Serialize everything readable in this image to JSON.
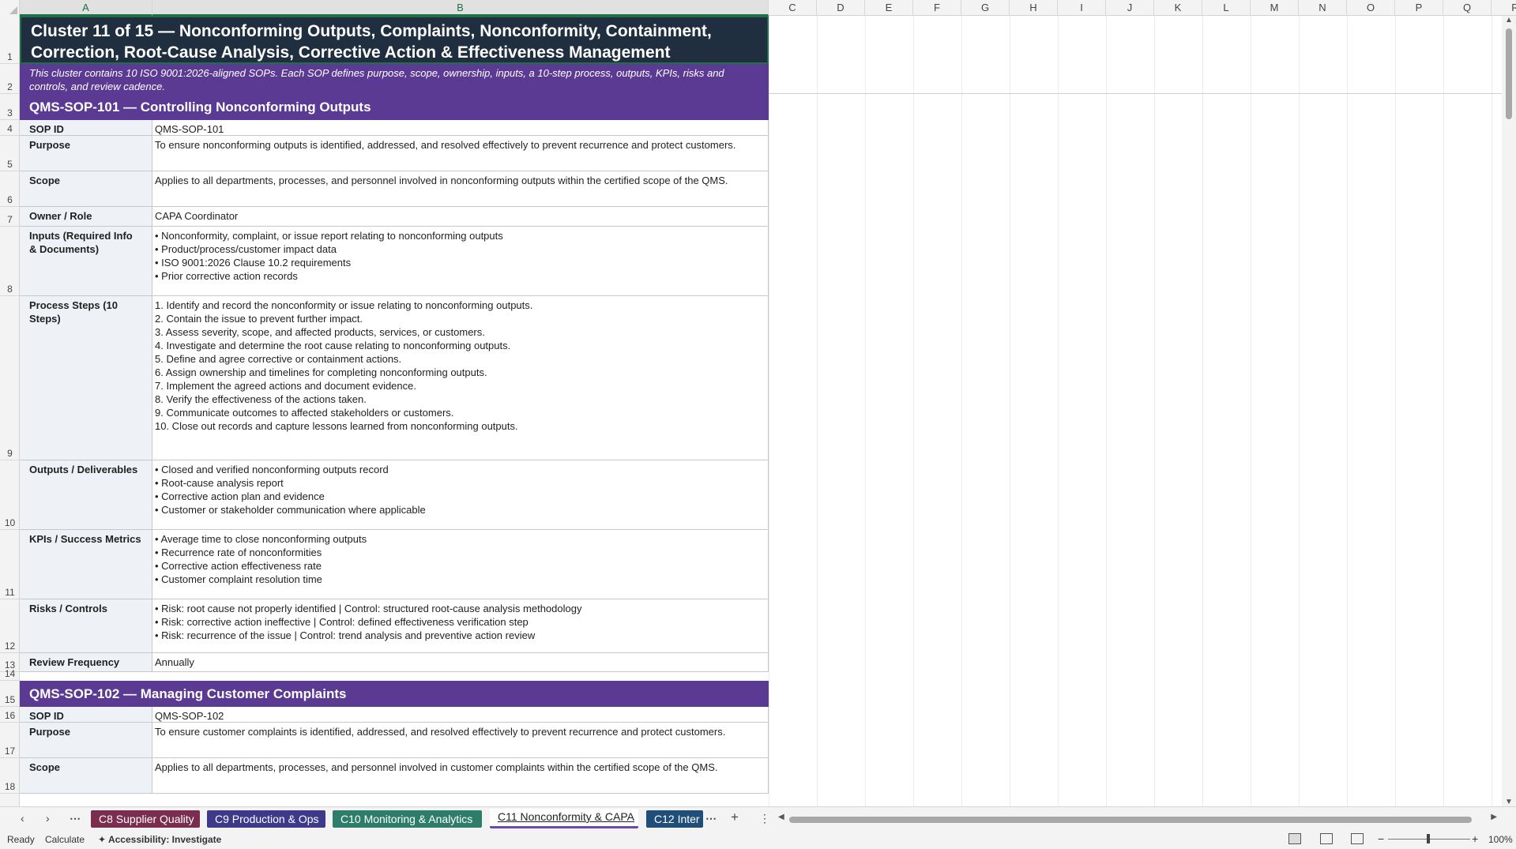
{
  "columns": [
    "A",
    "B",
    "C",
    "D",
    "E",
    "F",
    "G",
    "H",
    "I",
    "J",
    "K",
    "L",
    "M",
    "N",
    "O",
    "P",
    "Q",
    "R"
  ],
  "rows": [
    "1",
    "2",
    "3",
    "4",
    "5",
    "6",
    "7",
    "8",
    "9",
    "10",
    "11",
    "12",
    "13",
    "14",
    "15",
    "16",
    "17",
    "18"
  ],
  "cluster": {
    "title_line1": "Cluster 11 of 15  —  Nonconforming Outputs, Complaints, Nonconformity, Containment,",
    "title_line2": "Correction, Root-Cause Analysis, Corrective Action & Effectiveness Management",
    "description": "This cluster contains 10 ISO 9001:2026-aligned SOPs. Each SOP defines purpose, scope, ownership, inputs, a 10-step process, outputs, KPIs, risks and controls, and review cadence."
  },
  "sop1": {
    "heading": "QMS-SOP-101  —  Controlling Nonconforming Outputs",
    "rows": [
      {
        "label": "SOP ID",
        "lines": [
          "QMS-SOP-101"
        ]
      },
      {
        "label": "Purpose",
        "lines": [
          "To ensure nonconforming outputs is identified, addressed, and resolved effectively to prevent recurrence and protect customers."
        ]
      },
      {
        "label": "Scope",
        "lines": [
          "Applies to all departments, processes, and personnel involved in nonconforming outputs within the certified scope of the QMS."
        ]
      },
      {
        "label": "Owner / Role",
        "lines": [
          "CAPA Coordinator"
        ]
      },
      {
        "label": "Inputs (Required Info & Documents)",
        "lines": [
          "• Nonconformity, complaint, or issue report relating to nonconforming outputs",
          "• Product/process/customer impact data",
          "• ISO 9001:2026 Clause 10.2 requirements",
          "• Prior corrective action records"
        ]
      },
      {
        "label": "Process Steps (10 Steps)",
        "lines": [
          "1. Identify and record the nonconformity or issue relating to nonconforming outputs.",
          "2. Contain the issue to prevent further impact.",
          "3. Assess severity, scope, and affected products, services, or customers.",
          "4. Investigate and determine the root cause relating to nonconforming outputs.",
          "5. Define and agree corrective or containment actions.",
          "6. Assign ownership and timelines for completing nonconforming outputs.",
          "7. Implement the agreed actions and document evidence.",
          "8. Verify the effectiveness of the actions taken.",
          "9. Communicate outcomes to affected stakeholders or customers.",
          "10. Close out records and capture lessons learned from nonconforming outputs."
        ]
      },
      {
        "label": "Outputs / Deliverables",
        "lines": [
          "• Closed and verified nonconforming outputs record",
          "• Root-cause analysis report",
          "• Corrective action plan and evidence",
          "• Customer or stakeholder communication where applicable"
        ]
      },
      {
        "label": "KPIs / Success Metrics",
        "lines": [
          "• Average time to close nonconforming outputs",
          "• Recurrence rate of nonconformities",
          "• Corrective action effectiveness rate",
          "• Customer complaint resolution time"
        ]
      },
      {
        "label": "Risks / Controls",
        "lines": [
          "• Risk: root cause not properly identified | Control: structured root-cause analysis methodology",
          "• Risk: corrective action ineffective | Control: defined effectiveness verification step",
          "• Risk: recurrence of the issue | Control: trend analysis and preventive action review"
        ]
      },
      {
        "label": "Review Frequency",
        "lines": [
          "Annually"
        ]
      }
    ]
  },
  "sop2": {
    "heading": "QMS-SOP-102  —  Managing Customer Complaints",
    "rows": [
      {
        "label": "SOP ID",
        "lines": [
          "QMS-SOP-102"
        ]
      },
      {
        "label": "Purpose",
        "lines": [
          "To ensure customer complaints is identified, addressed, and resolved effectively to prevent recurrence and protect customers."
        ]
      },
      {
        "label": "Scope",
        "lines": [
          "Applies to all departments, processes, and personnel involved in customer complaints within the certified scope of the QMS."
        ]
      }
    ]
  },
  "tabs": [
    {
      "label": "C8 Supplier Quality",
      "color": "#7a2d4f"
    },
    {
      "label": "C9 Production & Ops",
      "color": "#3d3a8c"
    },
    {
      "label": "C10 Monitoring & Analytics",
      "color": "#2e7d6a"
    },
    {
      "label": "C11 Nonconformity & CAPA",
      "color": "#ffffff"
    },
    {
      "label": "C12 Inter",
      "color": "#1f4e79"
    }
  ],
  "status": {
    "ready": "Ready",
    "calculate": "Calculate",
    "accessibility": "Accessibility: Investigate",
    "zoom": "100%"
  }
}
